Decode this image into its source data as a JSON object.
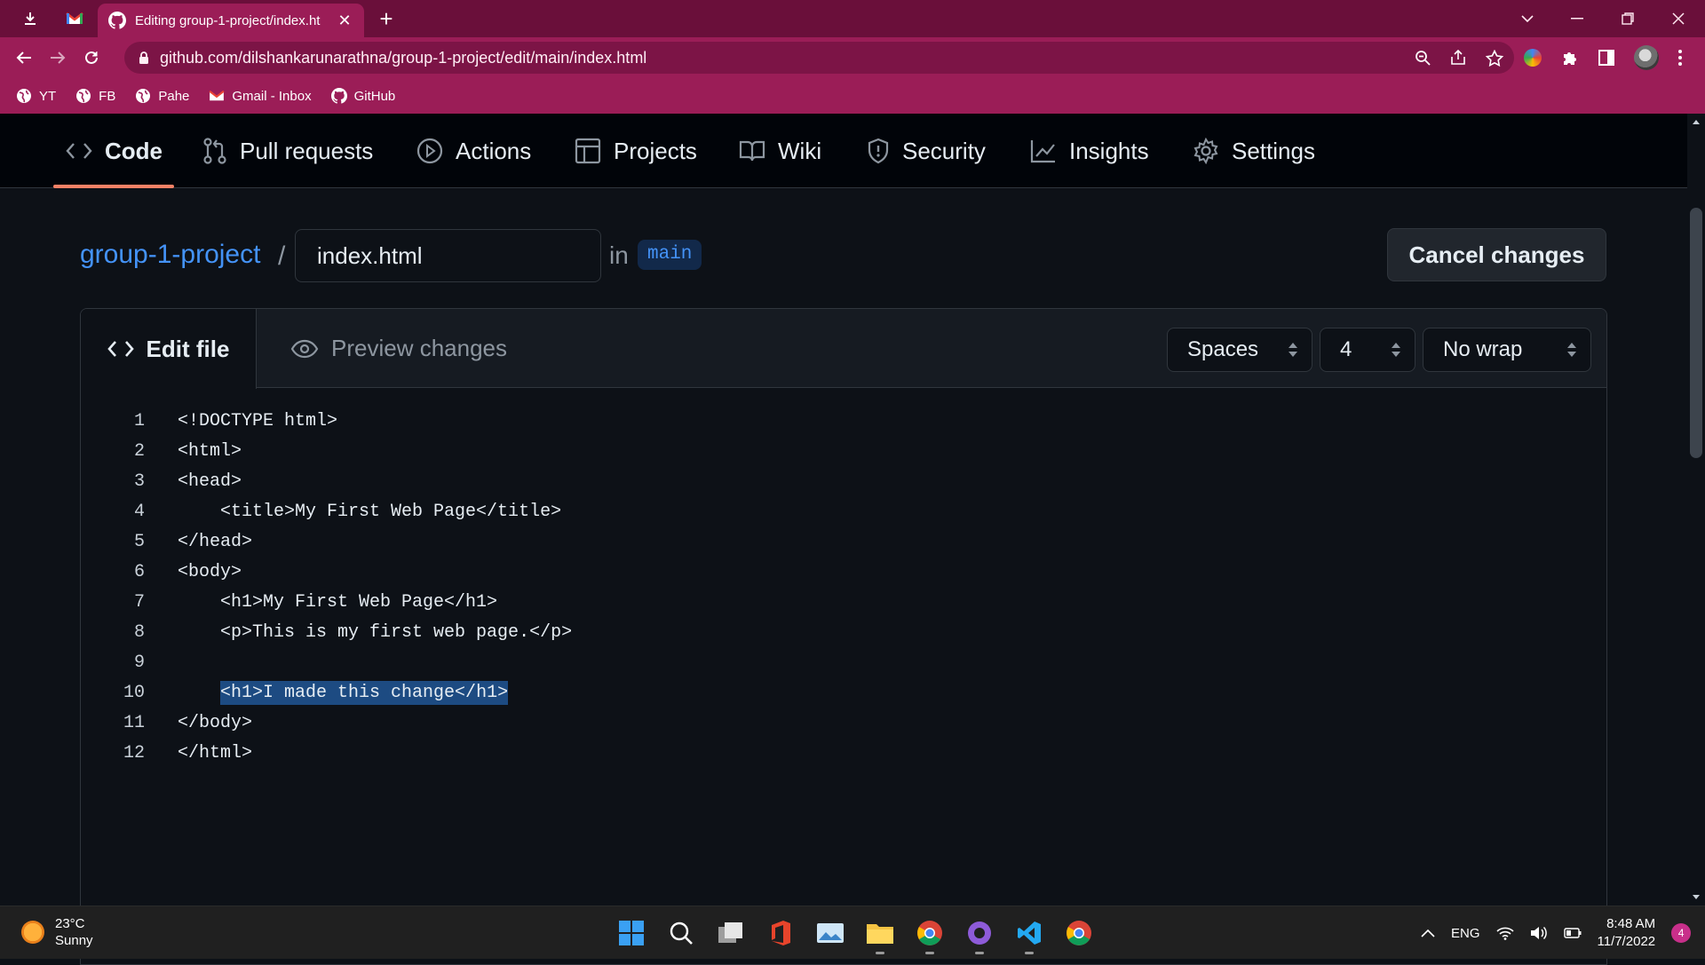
{
  "browser": {
    "tab_title": "Editing group-1-project/index.ht",
    "new_tab": "+",
    "url": "github.com/dilshankarunarathna/group-1-project/edit/main/index.html",
    "bookmarks": [
      {
        "label": "YT"
      },
      {
        "label": "FB"
      },
      {
        "label": "Pahe"
      },
      {
        "label": "Gmail - Inbox"
      },
      {
        "label": "GitHub"
      }
    ],
    "theme_color": "#9b1d57"
  },
  "repo_nav": {
    "items": [
      {
        "label": "Code",
        "icon": "code-icon",
        "active": true
      },
      {
        "label": "Pull requests",
        "icon": "pull-request-icon"
      },
      {
        "label": "Actions",
        "icon": "play-icon"
      },
      {
        "label": "Projects",
        "icon": "table-icon"
      },
      {
        "label": "Wiki",
        "icon": "book-icon"
      },
      {
        "label": "Security",
        "icon": "shield-icon"
      },
      {
        "label": "Insights",
        "icon": "graph-icon"
      },
      {
        "label": "Settings",
        "icon": "gear-icon"
      }
    ]
  },
  "breadcrumb": {
    "repo": "group-1-project",
    "separator": "/",
    "filename": "index.html",
    "in_label": "in",
    "branch": "main"
  },
  "actions": {
    "cancel_label": "Cancel changes"
  },
  "editor": {
    "tab_edit": "Edit file",
    "tab_preview": "Preview changes",
    "indent_mode": "Spaces",
    "indent_size": "4",
    "wrap_mode": "No wrap",
    "lines": [
      {
        "n": "1",
        "text": "<!DOCTYPE html>"
      },
      {
        "n": "2",
        "text": "<html>"
      },
      {
        "n": "3",
        "text": "<head>"
      },
      {
        "n": "4",
        "text": "    <title>My First Web Page</title>"
      },
      {
        "n": "5",
        "text": "</head>"
      },
      {
        "n": "6",
        "text": "<body>"
      },
      {
        "n": "7",
        "text": "    <h1>My First Web Page</h1>"
      },
      {
        "n": "8",
        "text": "    <p>This is my first web page.</p>"
      },
      {
        "n": "9",
        "text": ""
      },
      {
        "n": "10",
        "indent": "    ",
        "text": "<h1>I made this change</h1>",
        "selected": true
      },
      {
        "n": "11",
        "text": "</body>"
      },
      {
        "n": "12",
        "text": "</html>"
      }
    ]
  },
  "taskbar": {
    "temperature": "23°C",
    "condition": "Sunny",
    "language": "ENG",
    "time": "8:48 AM",
    "date": "11/7/2022",
    "notifications": "4"
  },
  "colors": {
    "link": "#4493f8",
    "active_underline": "#f78166",
    "selection": "#1d4b82"
  }
}
